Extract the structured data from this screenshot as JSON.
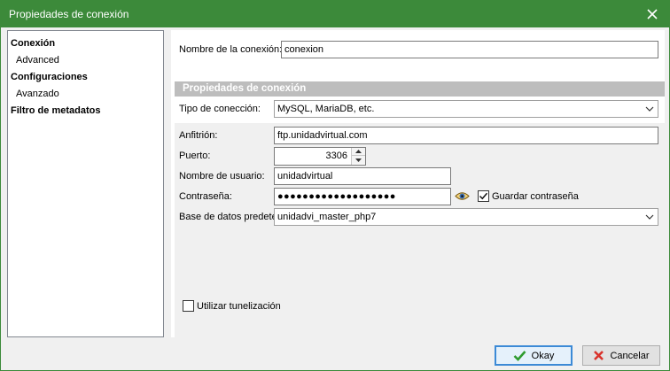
{
  "window": {
    "title": "Propiedades de conexión"
  },
  "tree": {
    "items": [
      {
        "label": "Conexión",
        "level": "root"
      },
      {
        "label": "Advanced",
        "level": "child"
      },
      {
        "label": "Configuraciones",
        "level": "root"
      },
      {
        "label": "Avanzado",
        "level": "child"
      },
      {
        "label": "Filtro de metadatos",
        "level": "root"
      }
    ]
  },
  "form": {
    "connection_name_label": "Nombre de la conexión:",
    "connection_name_value": "conexion",
    "section_title": "Propiedades de conexión",
    "connection_type_label": "Tipo de conección:",
    "connection_type_value": "MySQL, MariaDB, etc.",
    "host_label": "Anfitrión:",
    "host_value": "ftp.unidadvirtual.com",
    "port_label": "Puerto:",
    "port_value": "3306",
    "username_label": "Nombre de usuario:",
    "username_value": "unidadvirtual",
    "password_label": "Contraseña:",
    "password_value": "●●●●●●●●●●●●●●●●●●●",
    "save_password_label": "Guardar contraseña",
    "save_password_checked": true,
    "default_db_label": "Base de datos predeterminada:",
    "default_db_value": "unidadvi_master_php7",
    "tunnel_label": "Utilizar tunelización",
    "tunnel_checked": false
  },
  "buttons": {
    "ok_label": "Okay",
    "cancel_label": "Cancelar"
  },
  "colors": {
    "titlebar": "#3c8a3a",
    "section_header": "#bdbdbd",
    "ok_check": "#2e9b2e",
    "cancel_x": "#d9322b"
  },
  "icons": {
    "close": "close-icon",
    "chevron": "chevron-down-icon",
    "eye": "eye-icon",
    "check": "check-icon",
    "x": "x-icon"
  }
}
